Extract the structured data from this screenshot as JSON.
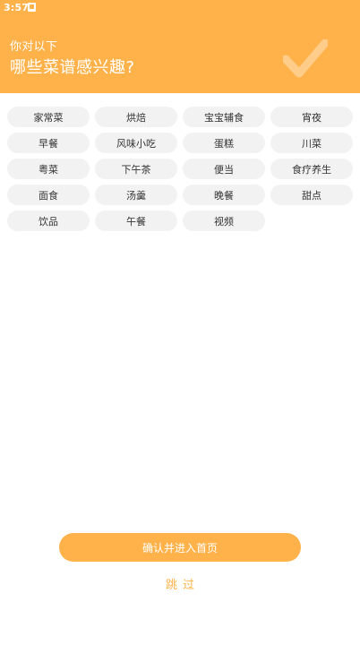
{
  "status_bar": {
    "time": "3:57"
  },
  "header": {
    "subtitle": "你对以下",
    "title": "哪些菜谱感兴趣?"
  },
  "tags": [
    "家常菜",
    "烘焙",
    "宝宝辅食",
    "宵夜",
    "早餐",
    "风味小吃",
    "蛋糕",
    "川菜",
    "粤菜",
    "下午茶",
    "便当",
    "食疗养生",
    "面食",
    "汤羹",
    "晚餐",
    "甜点",
    "饮品",
    "午餐",
    "视频"
  ],
  "confirm_label": "确认并进入首页",
  "skip_label": "跳过",
  "colors": {
    "accent": "#FFB24A",
    "tag_bg": "#F2F2F2"
  }
}
